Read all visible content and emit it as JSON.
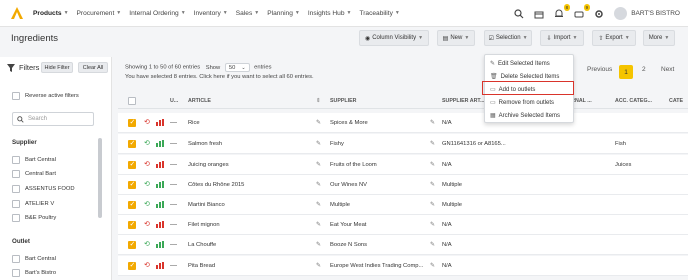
{
  "topbar": {
    "nav": [
      {
        "label": "Products",
        "active": true
      },
      {
        "label": "Procurement",
        "active": false
      },
      {
        "label": "Internal Ordering",
        "active": false
      },
      {
        "label": "Inventory",
        "active": false
      },
      {
        "label": "Sales",
        "active": false
      },
      {
        "label": "Planning",
        "active": false
      },
      {
        "label": "Insights Hub",
        "active": false
      },
      {
        "label": "Traceability",
        "active": false
      }
    ],
    "badges": {
      "store": "8",
      "cart": "9"
    },
    "user_name": "BART'S BISTRO"
  },
  "page_title": "Ingredients",
  "toolbar": {
    "column_visibility": "Column Visibility",
    "new": "New",
    "selection": "Selection",
    "import": "Import",
    "export": "Export",
    "more": "More"
  },
  "selection_menu": {
    "items": [
      "Edit Selected Items",
      "Delete Selected Items",
      "Add to outlets",
      "Remove from outlets",
      "Archive Selected Items"
    ]
  },
  "filters": {
    "title": "Filters",
    "hide_filter": "Hide Filter",
    "clear_all": "Clear All",
    "reverse_active": "Reverse active filters",
    "search_placeholder": "Search",
    "supplier_title": "Supplier",
    "suppliers": [
      "Bart Central",
      "Central Bart",
      "ASSENTUS FOOD",
      "ATELIER V",
      "B&E Poultry"
    ],
    "outlet_title": "Outlet",
    "outlets": [
      "Bart Central",
      "Bart's Bistro"
    ]
  },
  "info": {
    "showing": "Showing 1 to 50 of 60 entries",
    "show_label": "Show",
    "page_size": "50",
    "entries_label": "entries",
    "selected_text": "You have selected 8 entries. Click here if you want to select all 60 entries."
  },
  "pager": {
    "previous": "Previous",
    "current": "1",
    "page2": "2",
    "next": "Next"
  },
  "table": {
    "headers": {
      "u": "U...",
      "article": "ARTICLE",
      "supplier": "SUPPLIER",
      "supplier_art": "SUPPLIER ART...",
      "external": "...TERNAL ...",
      "acc_cat": "ACC. CATEG...",
      "cat": "CATE"
    },
    "rows": [
      {
        "article": "Rice",
        "supplier": "Spices & More",
        "supplier_art": "N/A",
        "acc_cat": "",
        "bar_color": "#d9342b"
      },
      {
        "article": "Salmon fresh",
        "supplier": "Fishy",
        "supplier_art": "GN11641316 or A8165...",
        "acc_cat": "Fish",
        "bar_color": "#3aa856"
      },
      {
        "article": "Juicing oranges",
        "supplier": "Fruits of the Loom",
        "supplier_art": "N/A",
        "acc_cat": "Juices",
        "bar_color": "#d9342b"
      },
      {
        "article": "Côtes du Rhône 2015",
        "supplier": "Our Wines NV",
        "supplier_art": "Multiple",
        "acc_cat": "",
        "bar_color": "#3aa856"
      },
      {
        "article": "Martini Bianco",
        "supplier": "Multiple",
        "supplier_art": "Multiple",
        "acc_cat": "",
        "bar_color": "#3aa856"
      },
      {
        "article": "Filet mignon",
        "supplier": "Eat Your Meat",
        "supplier_art": "N/A",
        "acc_cat": "",
        "bar_color": "#d9342b"
      },
      {
        "article": "La Chouffe",
        "supplier": "Booze N Sons",
        "supplier_art": "N/A",
        "acc_cat": "",
        "bar_color": "#3aa856"
      },
      {
        "article": "Pita Bread",
        "supplier": "Europe West Indies Trading Comp...",
        "supplier_art": "N/A",
        "acc_cat": "",
        "bar_color": "#d9342b"
      }
    ]
  },
  "colors": {
    "accent": "#f5c400",
    "checkbox": "#f2a900",
    "highlight": "#d9342b"
  }
}
